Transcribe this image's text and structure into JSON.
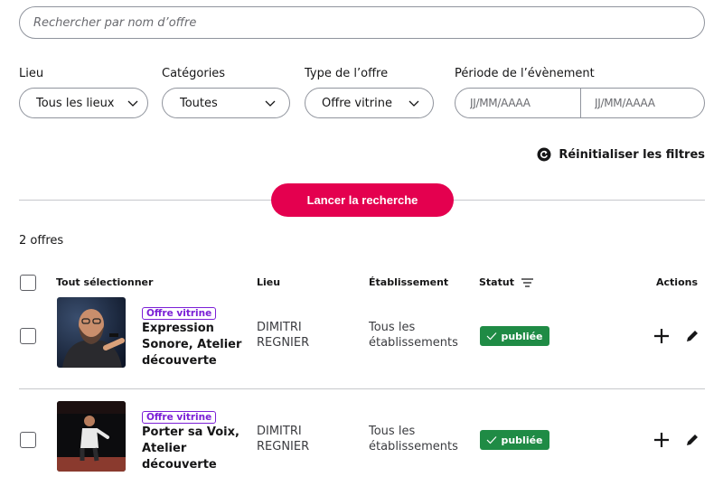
{
  "search": {
    "placeholder": "Rechercher par nom d’offre"
  },
  "filters": {
    "lieu": {
      "label": "Lieu",
      "value": "Tous les lieux"
    },
    "categories": {
      "label": "Catégories",
      "value": "Toutes"
    },
    "type": {
      "label": "Type de l’offre",
      "value": "Offre vitrine"
    },
    "periode": {
      "label": "Période de l’évènement",
      "start_placeholder": "JJ/MM/AAAA",
      "end_placeholder": "JJ/MM/AAAA"
    }
  },
  "reset_label": "Réinitialiser les filtres",
  "launch_label": "Lancer la recherche",
  "count_label": "2 offres",
  "table": {
    "headers": {
      "select_all": "Tout sélectionner",
      "lieu": "Lieu",
      "etablissement": "Établissement",
      "statut": "Statut",
      "actions": "Actions"
    },
    "rows": [
      {
        "badge": "Offre vitrine",
        "title": "Expression Sonore, Atelier découverte",
        "lieu": "DIMITRI REGNIER",
        "etablissement": "Tous les établissements",
        "status": "publiée"
      },
      {
        "badge": "Offre vitrine",
        "title": "Porter sa Voix, Atelier découverte",
        "lieu": "DIMITRI REGNIER",
        "etablissement": "Tous les établissements",
        "status": "publiée"
      }
    ]
  },
  "colors": {
    "accent": "#e4004f",
    "badge": "#7b1fd6",
    "status": "#1f8b45"
  },
  "icons": [
    "chevron-down-icon",
    "reset-icon",
    "sort-icon",
    "check-icon",
    "plus-icon",
    "pencil-icon"
  ]
}
